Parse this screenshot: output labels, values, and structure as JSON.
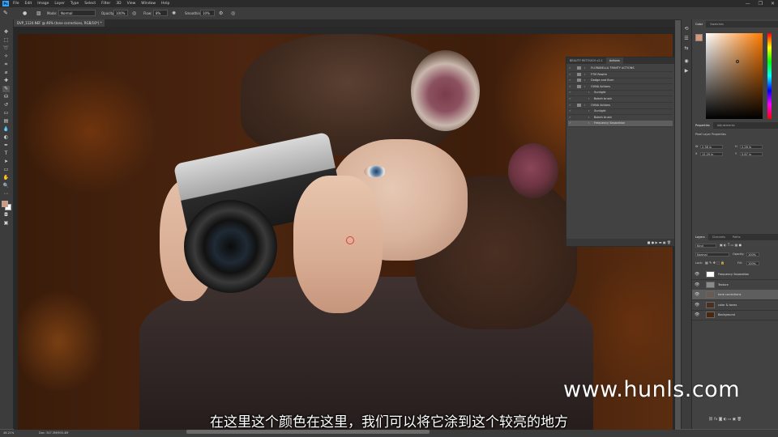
{
  "app": {
    "logo": "Ps",
    "menu": [
      "File",
      "Edit",
      "Image",
      "Layer",
      "Type",
      "Select",
      "Filter",
      "3D",
      "View",
      "Window",
      "Help"
    ],
    "window_controls": [
      "—",
      "❐",
      "✕"
    ]
  },
  "options_bar": {
    "mode_label": "Mode:",
    "mode_value": "Normal",
    "opacity_label": "Opacity:",
    "opacity_value": "100%",
    "flow_label": "Flow:",
    "flow_value": "8%",
    "smoothing_label": "Smoothing:",
    "smoothing_value": "10%"
  },
  "document_tab": {
    "title": "DVP_1124.NEF @ 46% (tone corrections, RGB/16*) *"
  },
  "actions_panel": {
    "tabs": [
      "BEAUTY RETOUCH v2.1",
      "Actions"
    ],
    "rows": [
      {
        "label": "FLORABELLA TRINITY ACTIONS",
        "check": "✓",
        "folder": true,
        "sub": false,
        "selected": false
      },
      {
        "label": "FTM Rewire",
        "check": "✓",
        "folder": true,
        "sub": false,
        "selected": false
      },
      {
        "label": "Dodge and Burn",
        "check": "✓",
        "folder": true,
        "sub": false,
        "selected": false
      },
      {
        "label": "OVNA Actions",
        "check": "✓",
        "folder": true,
        "sub": false,
        "selected": false
      },
      {
        "label": "Sunlight",
        "check": "✓",
        "folder": false,
        "sub": true,
        "selected": false
      },
      {
        "label": "Bokeh brush",
        "check": "✓",
        "folder": false,
        "sub": true,
        "selected": false
      },
      {
        "label": "OVNA Actions",
        "check": "✓",
        "folder": true,
        "sub": false,
        "selected": false
      },
      {
        "label": "Sunlight",
        "check": "✓",
        "folder": false,
        "sub": true,
        "selected": false
      },
      {
        "label": "Bokeh brush",
        "check": "✓",
        "folder": false,
        "sub": true,
        "selected": false
      },
      {
        "label": "Frequency Separation",
        "check": "✓",
        "folder": false,
        "sub": true,
        "selected": true
      }
    ],
    "bottom_icons": "■ ● ▶ ▬ ▣ 🗑"
  },
  "color_panel": {
    "tabs": [
      "Color",
      "Swatches"
    ],
    "foreground": "#d99777",
    "background": "#ffffff"
  },
  "properties_panel": {
    "tabs": [
      "Properties",
      "Adjustments"
    ],
    "title": "Pixel Layer Properties",
    "w_label": "W",
    "w_value": "2.38 in",
    "h_label": "H",
    "h_value": "2.26 in",
    "x_label": "X",
    "x_value": "12.29 in",
    "y_label": "Y",
    "y_value": "5.67 in"
  },
  "layers_panel": {
    "tabs": [
      "Layers",
      "Channels",
      "Paths"
    ],
    "kind_label": "Kind",
    "blend_mode": "Normal",
    "opacity_label": "Opacity:",
    "opacity_value": "100%",
    "lock_label": "Lock:",
    "fill_label": "Fill:",
    "fill_value": "100%",
    "layers": [
      {
        "name": "Frequency Separation",
        "group": true,
        "selected": false,
        "thumb": "#ffffff"
      },
      {
        "name": "Texture",
        "group": false,
        "selected": false,
        "thumb": "#8a8a8a"
      },
      {
        "name": "tone corrections",
        "group": false,
        "selected": true,
        "thumb": "#6b5a50"
      },
      {
        "name": "color & tones",
        "group": false,
        "selected": false,
        "thumb": "#4a3020"
      },
      {
        "name": "Background",
        "group": false,
        "selected": false,
        "thumb": "#4a2810"
      }
    ]
  },
  "status_bar": {
    "zoom": "46.21%",
    "doc": "Doc: 347.3M/905.4M"
  },
  "overlay": {
    "watermark": "www.hunls.com",
    "subtitle": "在这里这个颜色在这里，我们可以将它涂到这个较亮的地方"
  }
}
